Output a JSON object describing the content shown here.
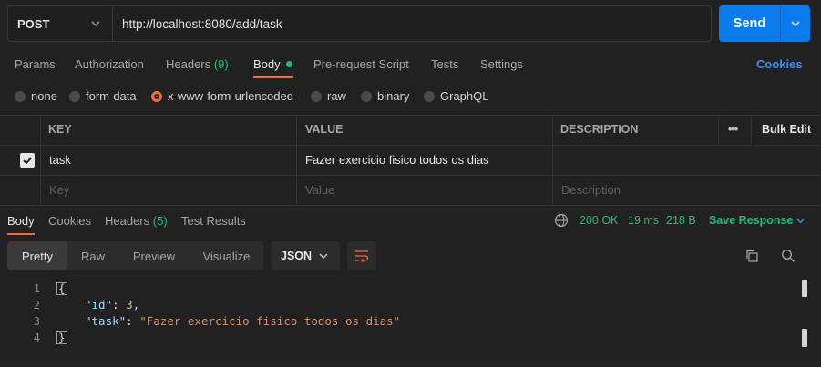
{
  "request": {
    "method": "POST",
    "url": "http://localhost:8080/add/task",
    "send_label": "Send"
  },
  "request_tabs": {
    "params": "Params",
    "authorization": "Authorization",
    "headers": "Headers",
    "headers_count": "(9)",
    "body": "Body",
    "prerequest": "Pre-request Script",
    "tests": "Tests",
    "settings": "Settings",
    "cookies": "Cookies"
  },
  "body_types": {
    "none": "none",
    "form_data": "form-data",
    "urlencoded": "x-www-form-urlencoded",
    "raw": "raw",
    "binary": "binary",
    "graphql": "GraphQL",
    "selected": "x-www-form-urlencoded"
  },
  "table": {
    "headers": {
      "key": "KEY",
      "value": "VALUE",
      "description": "DESCRIPTION",
      "more": "•••",
      "bulk_edit": "Bulk Edit"
    },
    "rows": [
      {
        "checked": true,
        "key": "task",
        "value": "Fazer exercicio fisico todos os dias",
        "description": ""
      }
    ],
    "placeholders": {
      "key": "Key",
      "value": "Value",
      "description": "Description"
    }
  },
  "response_tabs": {
    "body": "Body",
    "cookies": "Cookies",
    "headers": "Headers",
    "headers_count": "(5)",
    "test_results": "Test Results"
  },
  "response_status": {
    "status": "200 OK",
    "time": "19 ms",
    "size": "218 B",
    "save_response": "Save Response"
  },
  "viewer": {
    "modes": {
      "pretty": "Pretty",
      "raw": "Raw",
      "preview": "Preview",
      "visualize": "Visualize"
    },
    "format": "JSON"
  },
  "response_body": {
    "line_numbers": [
      "1",
      "2",
      "3",
      "4"
    ],
    "open_brace": "{",
    "close_brace": "}",
    "id_key": "\"id\"",
    "id_value": "3",
    "task_key": "\"task\"",
    "task_value": "\"Fazer exercicio fisico todos os dias\""
  },
  "colors": {
    "accent_orange": "#f26b3a",
    "send_blue": "#097bed",
    "status_green": "#1dbf73",
    "link_blue": "#3b8ef0"
  }
}
